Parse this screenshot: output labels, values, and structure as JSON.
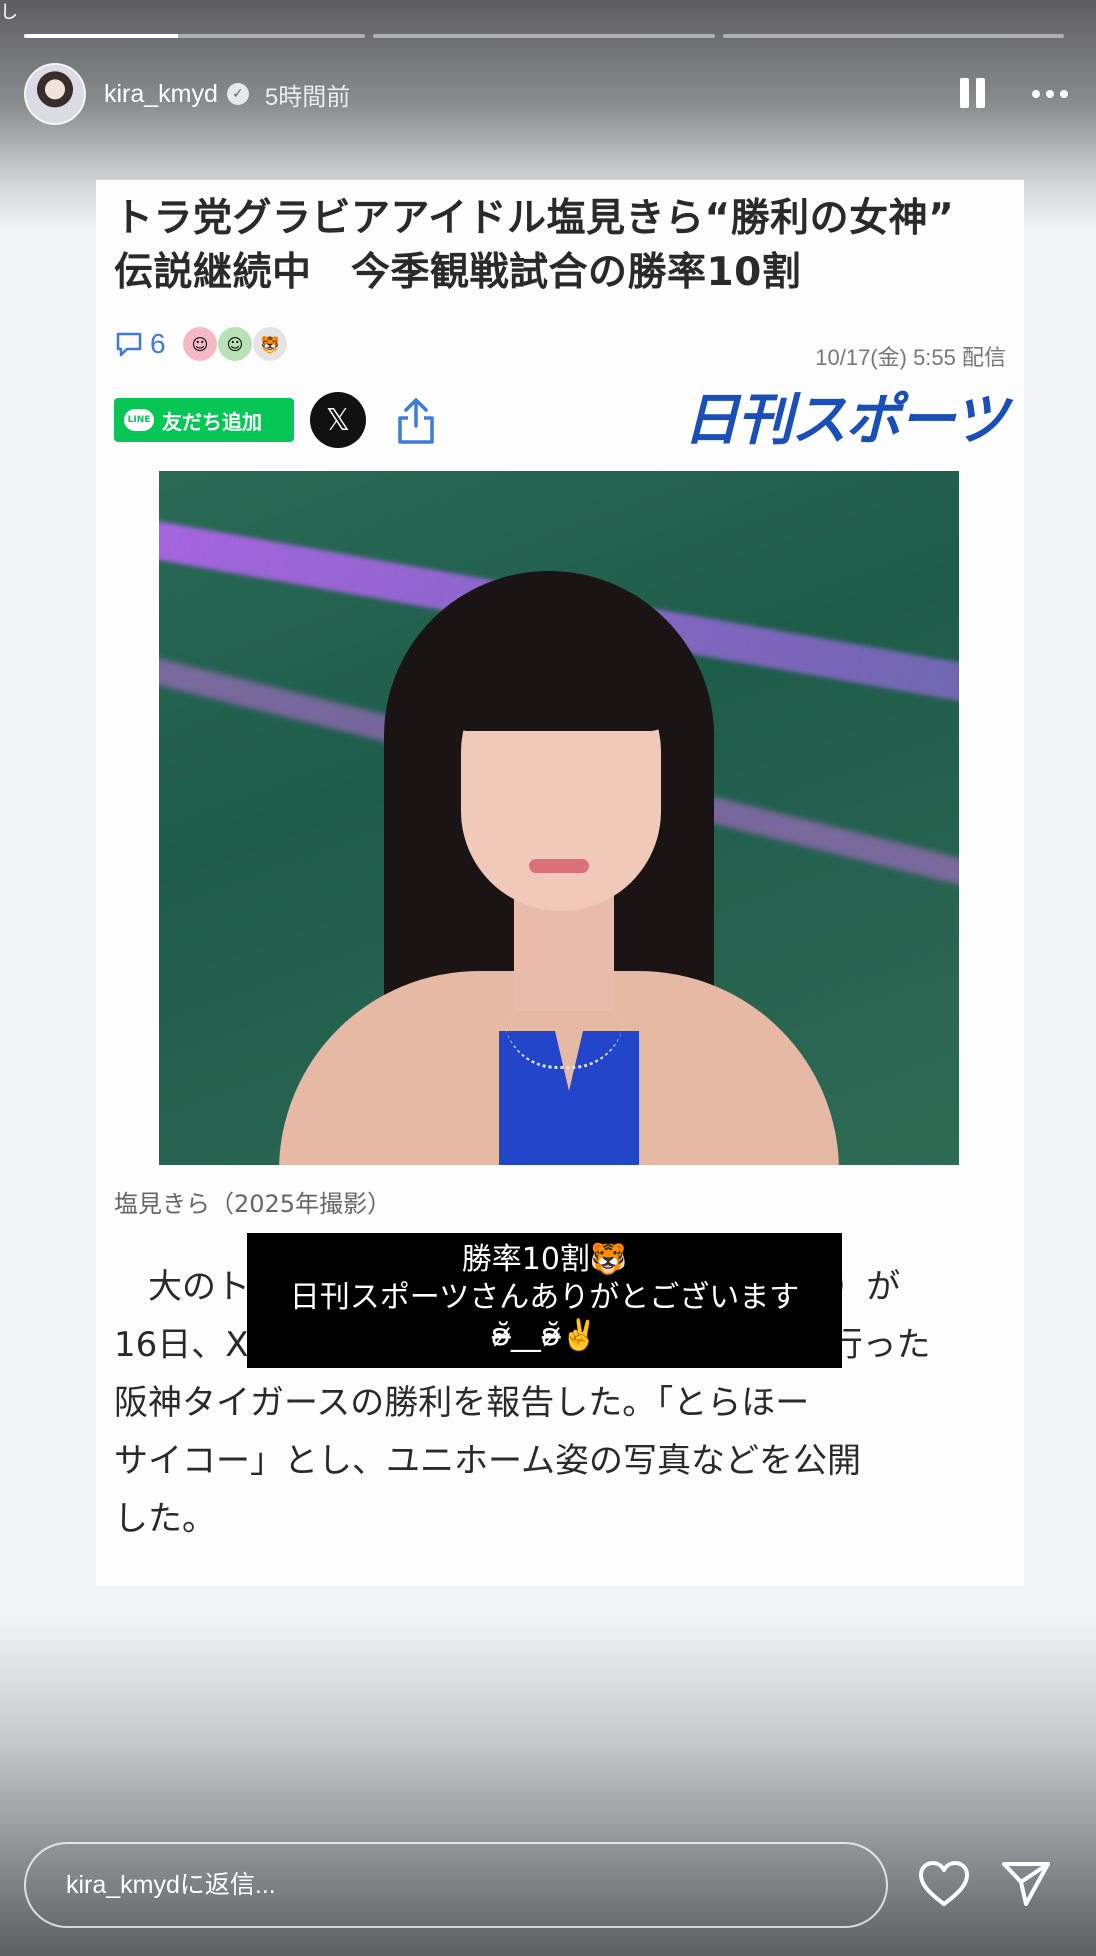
{
  "story": {
    "progress_segments": [
      0.45,
      0,
      0
    ],
    "edge_glyph": "し",
    "username": "kira_kmyd",
    "time_ago": "5時間前",
    "verified": true
  },
  "article": {
    "headline_line1": "トラ党グラビアアイドル塩見きら“勝利の女神”",
    "headline_line2": "伝説継続中　今季観戦試合の勝率10割",
    "comment_count": "6",
    "dateline": "10/17(金) 5:55 配信",
    "line_button_label": "友だち追加",
    "line_logo_text": "LINE",
    "x_label": "𝕏",
    "brand": "日刊スポーツ",
    "photo_caption": "塩見きら（2025年撮影）",
    "body_line1": "　大のト",
    "body_line1_end": "（26）が",
    "body_line2": "16日、X",
    "body_line2_end": "行った",
    "body_line3": "阪神タイガースの勝利を報告した。「とらほー",
    "body_line4": "サイコー」とし、ユニホーム姿の写真などを公開",
    "body_line5": "した。"
  },
  "sticker": {
    "line1": "勝率10割🐯",
    "line2": "日刊スポーツさんありがとございます",
    "line3": "ʚ̴̶̷̆__ʚ̴̶̷̆✌️"
  },
  "reply": {
    "placeholder": "kira_kmydに返信..."
  },
  "colors": {
    "accent_blue": "#3c7dd9",
    "line_green": "#06c755",
    "brand_blue": "#1a4fb8"
  }
}
